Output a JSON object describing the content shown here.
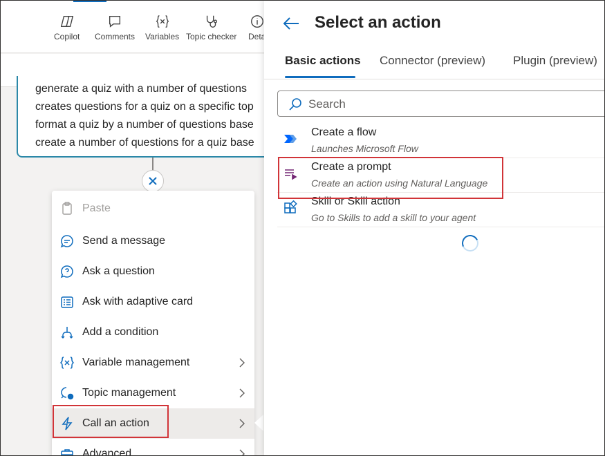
{
  "toolbar": {
    "buttons": [
      {
        "label": "Copilot",
        "icon": "copilot-icon"
      },
      {
        "label": "Comments",
        "icon": "comment-icon"
      },
      {
        "label": "Variables",
        "icon": "variables-icon"
      },
      {
        "label": "Topic checker",
        "icon": "stethoscope-icon"
      },
      {
        "label": "Deta",
        "icon": "info-icon"
      }
    ]
  },
  "node": {
    "lines": [
      "generate a quiz with a number of questions",
      "creates questions for a quiz on a specific top",
      "format a quiz by a number of questions base",
      "create a number of questions for a quiz base"
    ]
  },
  "menu": {
    "items": [
      {
        "label": "Paste",
        "icon": "clipboard-icon",
        "disabled": true
      },
      {
        "label": "Send a message",
        "icon": "message-icon"
      },
      {
        "label": "Ask a question",
        "icon": "question-icon"
      },
      {
        "label": "Ask with adaptive card",
        "icon": "adaptive-card-icon"
      },
      {
        "label": "Add a condition",
        "icon": "branch-icon"
      },
      {
        "label": "Variable management",
        "icon": "variables-icon",
        "submenu": true
      },
      {
        "label": "Topic management",
        "icon": "topic-icon",
        "submenu": true
      },
      {
        "label": "Call an action",
        "icon": "lightning-icon",
        "submenu": true,
        "active": true
      },
      {
        "label": "Advanced",
        "icon": "toolbox-icon",
        "submenu": true
      }
    ]
  },
  "panel": {
    "title": "Select an action",
    "tabs": [
      "Basic actions",
      "Connector (preview)",
      "Plugin (preview)"
    ],
    "active_tab": "Basic actions",
    "search_placeholder": "Search",
    "actions": [
      {
        "title": "Create a flow",
        "description": "Launches Microsoft Flow",
        "icon": "power-automate-icon"
      },
      {
        "title": "Create a prompt",
        "description": "Create an action using Natural Language",
        "icon": "prompt-icon"
      },
      {
        "title": "Skill or Skill action",
        "description": "Go to Skills to add a skill to your agent",
        "icon": "skill-icon"
      }
    ]
  },
  "colors": {
    "accent": "#0f6cbd",
    "highlight_box": "#d13438",
    "node_border": "#2b88a8"
  }
}
